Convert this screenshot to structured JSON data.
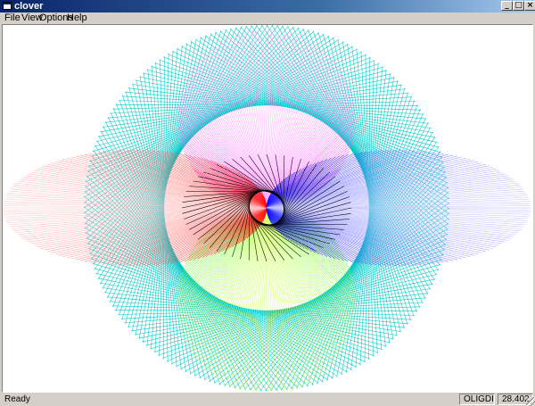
{
  "window": {
    "title": "clover",
    "controls": {
      "minimize": "_",
      "maximize": "□",
      "close": "×"
    }
  },
  "menu": {
    "file": "File",
    "view": "View",
    "options": "Options",
    "help": "Help"
  },
  "status": {
    "text": "Ready",
    "mode": "OLIGDI",
    "value": "28.402"
  },
  "drawing": {
    "colors": {
      "background": "#ffffff",
      "outer_circle": "#00c8c8",
      "top_petal": "#ff00ff",
      "left_petal": "#ff0000",
      "right_petal": "#0000ff",
      "bottom_petal": "#00ff00",
      "center": "#000000",
      "fade_top": "#ffd0ff",
      "fade_left": "#ffe8e8",
      "fade_right": "#e8e8ff",
      "fade_bottom": "#ffff90"
    }
  }
}
